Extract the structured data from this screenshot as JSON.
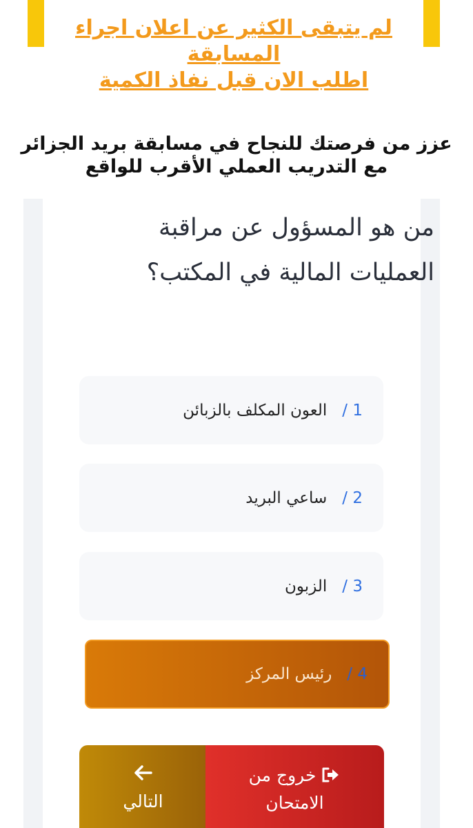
{
  "promo": {
    "line1": "لم يتبقى الكثير عن اعلان اجراء المسابقة",
    "line2": "اطلب الان قبل نفاذ الكمية"
  },
  "subheading": "عزز من فرصتك للنجاح في مسابقة بريد الجزائر مع التدريب العملي الأقرب للواقع",
  "question": "من هو المسؤول عن مراقبة العمليات المالية في المكتب؟",
  "options": [
    {
      "num": "1 /",
      "text": "العون المكلف بالزبائن"
    },
    {
      "num": "2 /",
      "text": "ساعي البريد"
    },
    {
      "num": "3 /",
      "text": "الزبون"
    },
    {
      "num": "4 /",
      "text": "رئيس المركز",
      "selected": true
    }
  ],
  "buttons": {
    "next_label": "التالي",
    "next_icon": "arrow-left-icon",
    "exit_label": "خروج من الامتحان",
    "exit_icon": "sign-out-icon"
  },
  "colors": {
    "banner_yellow": "#f8c70a",
    "promo_orange": "#f39a1c",
    "selected_orange": "#d97a08",
    "option_number_blue": "#2f6fe0",
    "exit_red": "#e0302a",
    "next_gold": "#c08a08"
  }
}
